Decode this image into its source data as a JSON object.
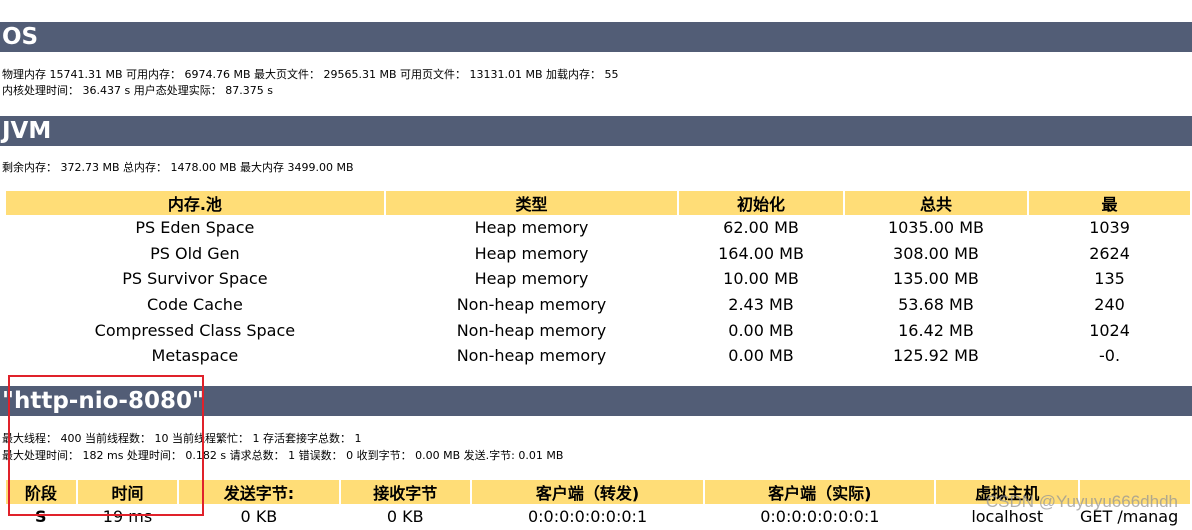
{
  "os": {
    "title": "OS",
    "line1": "物理内存 15741.31 MB 可用内存： 6974.76 MB 最大页文件： 29565.31 MB 可用页文件： 13131.01 MB 加载内存： 55",
    "line2": "内核处理时间： 36.437 s 用户态处理实际： 87.375 s"
  },
  "jvm": {
    "title": "JVM",
    "line1": "剩余内存： 372.73 MB 总内存： 1478.00 MB 最大内存 3499.00 MB",
    "headers": [
      "内存.池",
      "类型",
      "初始化",
      "总共",
      "最"
    ],
    "rows": [
      [
        "PS Eden Space",
        "Heap memory",
        "62.00 MB",
        "1035.00 MB",
        "1039"
      ],
      [
        "PS Old Gen",
        "Heap memory",
        "164.00 MB",
        "308.00 MB",
        "2624"
      ],
      [
        "PS Survivor Space",
        "Heap memory",
        "10.00 MB",
        "135.00 MB",
        "135"
      ],
      [
        "Code Cache",
        "Non-heap memory",
        "2.43 MB",
        "53.68 MB",
        "240"
      ],
      [
        "Compressed Class Space",
        "Non-heap memory",
        "0.00 MB",
        "16.42 MB",
        "1024"
      ],
      [
        "Metaspace",
        "Non-heap memory",
        "0.00 MB",
        "125.92 MB",
        "-0."
      ]
    ]
  },
  "connector": {
    "title": "\"http-nio-8080\"",
    "line1": "最大线程： 400 当前线程数： 10 当前线程繁忙： 1 存活套接字总数： 1",
    "line2": "最大处理时间： 182 ms 处理时间： 0.182 s 请求总数： 1 错误数： 0 收到字节： 0.00 MB 发送.字节: 0.01 MB",
    "headers": [
      "阶段",
      "时间",
      "发送字节:",
      "接收字节",
      "客户端（转发)",
      "客户端（实际)",
      "虚拟主机",
      ""
    ],
    "rows": [
      [
        "S",
        "19 ms",
        "0 KB",
        "0 KB",
        "0:0:0:0:0:0:0:1",
        "0:0:0:0:0:0:0:1",
        "localhost",
        "GET /manag"
      ]
    ]
  },
  "watermark": "CSDN @Yuyuyu666dhdh",
  "colors": {
    "section_bar": "#525d76",
    "header_cell": "#ffdd77",
    "highlight": "#e0212a"
  }
}
